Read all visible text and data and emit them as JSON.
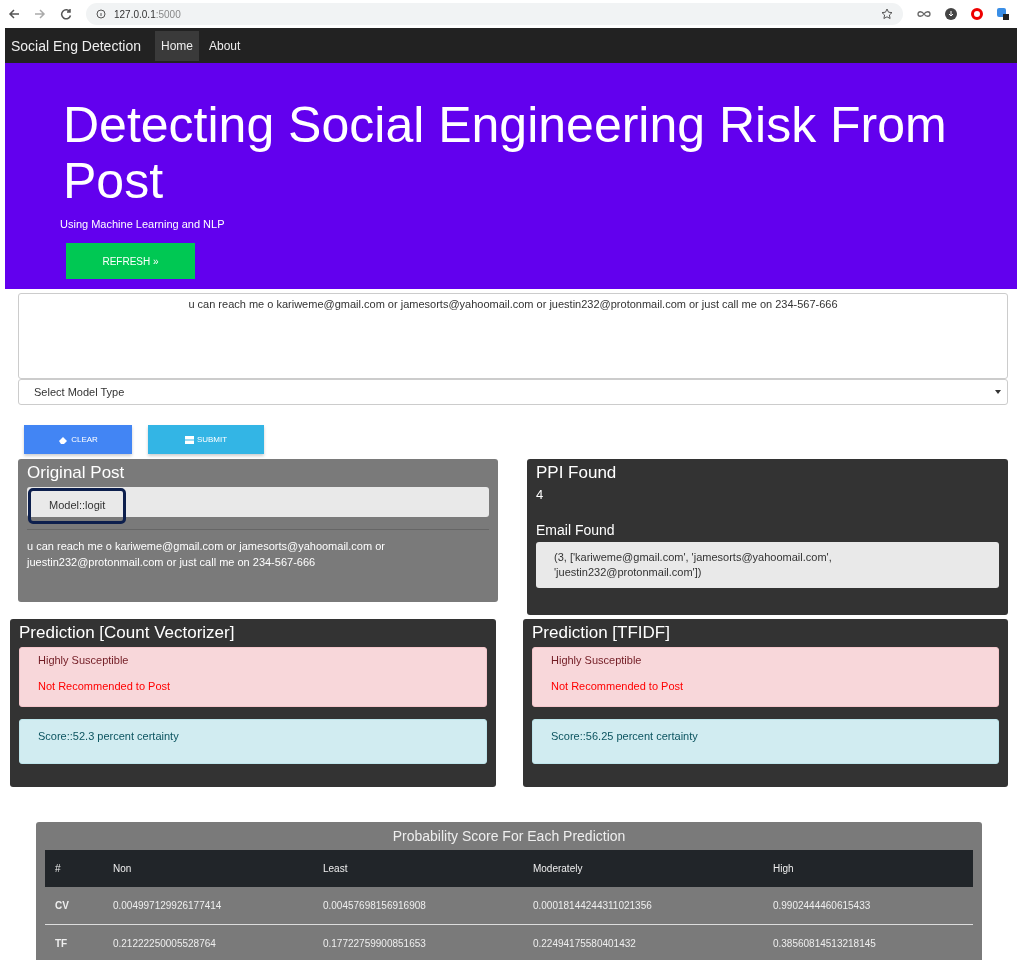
{
  "browser": {
    "url_host": "127.0.0.1",
    "url_port": ":5000"
  },
  "navbar": {
    "brand": "Social Eng Detection",
    "links": [
      {
        "label": "Home",
        "selected": true
      },
      {
        "label": "About",
        "selected": false
      }
    ]
  },
  "hero": {
    "title": "Detecting Social Engineering Risk From Post",
    "subtitle": "Using Machine Learning and NLP",
    "button": "REFRESH »"
  },
  "form": {
    "post_value": "u can reach me o kariweme@gmail.com or jamesorts@yahoomail.com or juestin232@protonmail.com or just call me on 234-567-666",
    "select_placeholder": "Select Model Type",
    "buttons": [
      {
        "label": "CLEAR",
        "kind": "clear"
      },
      {
        "label": "SUBMIT",
        "kind": "submit"
      }
    ]
  },
  "original_post": {
    "title": "Original Post",
    "model": "Model::logit",
    "model_highlighted": true,
    "text": "u can reach me o kariweme@gmail.com or jamesorts@yahoomail.com or juestin232@protonmail.com or just call me on 234-567-666"
  },
  "ppi": {
    "title": "PPI Found",
    "count": "4",
    "email_title": "Email Found",
    "emails": "(3, ['kariweme@gmail.com', 'jamesorts@yahoomail.com', 'juestin232@protonmail.com'])"
  },
  "predictions": [
    {
      "title": "Prediction [Count Vectorizer]",
      "verdict": "Highly Susceptible",
      "advice": "Not Recommended to Post",
      "score": "Score::52.3 percent certainty"
    },
    {
      "title": "Prediction [TFIDF]",
      "verdict": "Highly Susceptible",
      "advice": "Not Recommended to Post",
      "score": "Score::56.25 percent certainty"
    }
  ],
  "table": {
    "caption": "Probability Score For Each Prediction",
    "columns": [
      "#",
      "Non",
      "Least",
      "Moderately",
      "High"
    ],
    "rows": [
      [
        "CV",
        "0.004997129926177414",
        "0.00457698156916908",
        "0.00018144244311021356",
        "0.9902444460615433"
      ],
      [
        "TF",
        "0.21222250005528764",
        "0.17722759900851653",
        "0.22494175580401432",
        "0.38560814513218145"
      ]
    ]
  }
}
